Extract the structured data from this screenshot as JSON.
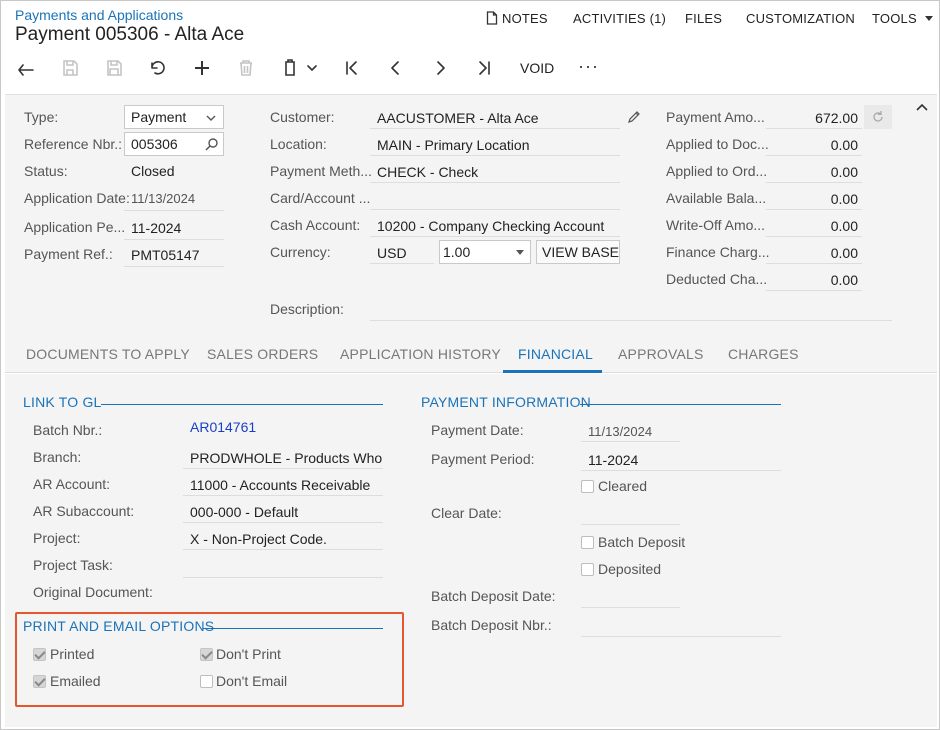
{
  "breadcrumb": "Payments and Applications",
  "title": "Payment 005306 - Alta Ace",
  "top_menu": {
    "notes": "NOTES",
    "activities": "ACTIVITIES (1)",
    "files": "FILES",
    "customization": "CUSTOMIZATION",
    "tools": "TOOLS"
  },
  "toolbar": {
    "void": "VOID",
    "more": "···"
  },
  "summary": {
    "type": {
      "label": "Type:",
      "value": "Payment"
    },
    "reference_nbr": {
      "label": "Reference Nbr.:",
      "value": "005306"
    },
    "status": {
      "label": "Status:",
      "value": "Closed"
    },
    "application_date": {
      "label": "Application Date:",
      "value": "11/13/2024"
    },
    "application_period": {
      "label": "Application Pe...",
      "value": "11-2024"
    },
    "payment_ref": {
      "label": "Payment Ref.:",
      "value": "PMT05147"
    },
    "customer": {
      "label": "Customer:",
      "value": "AACUSTOMER - Alta Ace"
    },
    "location": {
      "label": "Location:",
      "value": "MAIN - Primary Location"
    },
    "payment_method": {
      "label": "Payment Meth...",
      "value": "CHECK - Check"
    },
    "card_account": {
      "label": "Card/Account ...",
      "value": ""
    },
    "cash_account": {
      "label": "Cash Account:",
      "value": "10200 - Company Checking Account"
    },
    "currency": {
      "label": "Currency:",
      "value": "USD",
      "rate": "1.00",
      "view_base": "VIEW BASE"
    },
    "description": {
      "label": "Description:",
      "value": ""
    },
    "payment_amount": {
      "label": "Payment Amo...",
      "value": "672.00"
    },
    "applied_to_documents": {
      "label": "Applied to Doc...",
      "value": "0.00"
    },
    "applied_to_orders": {
      "label": "Applied to Ord...",
      "value": "0.00"
    },
    "available_balance": {
      "label": "Available Bala...",
      "value": "0.00"
    },
    "write_off_amount": {
      "label": "Write-Off Amo...",
      "value": "0.00"
    },
    "finance_charges": {
      "label": "Finance Charg...",
      "value": "0.00"
    },
    "deducted_charges": {
      "label": "Deducted Cha...",
      "value": "0.00"
    }
  },
  "tabs": [
    {
      "label": "DOCUMENTS TO APPLY"
    },
    {
      "label": "SALES ORDERS"
    },
    {
      "label": "APPLICATION HISTORY"
    },
    {
      "label": "FINANCIAL"
    },
    {
      "label": "APPROVALS"
    },
    {
      "label": "CHARGES"
    }
  ],
  "active_tab": "FINANCIAL",
  "link_to_gl": {
    "title": "LINK TO GL",
    "batch_nbr": {
      "label": "Batch Nbr.:",
      "value": "AR014761"
    },
    "branch": {
      "label": "Branch:",
      "value": "PRODWHOLE - Products Whole"
    },
    "ar_account": {
      "label": "AR Account:",
      "value": "11000 - Accounts Receivable"
    },
    "ar_subaccount": {
      "label": "AR Subaccount:",
      "value": "000-000 - Default"
    },
    "project": {
      "label": "Project:",
      "value": "X - Non-Project Code."
    },
    "project_task": {
      "label": "Project Task:",
      "value": ""
    },
    "original_document": {
      "label": "Original Document:",
      "value": ""
    }
  },
  "print_email": {
    "title": "PRINT AND EMAIL OPTIONS",
    "printed": {
      "label": "Printed",
      "checked": true
    },
    "dont_print": {
      "label": "Don't Print",
      "checked": true
    },
    "emailed": {
      "label": "Emailed",
      "checked": true
    },
    "dont_email": {
      "label": "Don't Email",
      "checked": false
    }
  },
  "payment_info": {
    "title": "PAYMENT INFORMATION",
    "payment_date": {
      "label": "Payment Date:",
      "value": "11/13/2024"
    },
    "payment_period": {
      "label": "Payment Period:",
      "value": "11-2024"
    },
    "cleared": {
      "label": "Cleared",
      "checked": false
    },
    "clear_date": {
      "label": "Clear Date:",
      "value": ""
    },
    "batch_deposit": {
      "label": "Batch Deposit",
      "checked": false
    },
    "deposited": {
      "label": "Deposited",
      "checked": false
    },
    "batch_deposit_date": {
      "label": "Batch Deposit Date:",
      "value": ""
    },
    "batch_deposit_nbr": {
      "label": "Batch Deposit Nbr.:",
      "value": ""
    }
  },
  "colors": {
    "accent": "#1a73b8",
    "highlight": "#e4572e",
    "link": "#1a3fc7"
  }
}
